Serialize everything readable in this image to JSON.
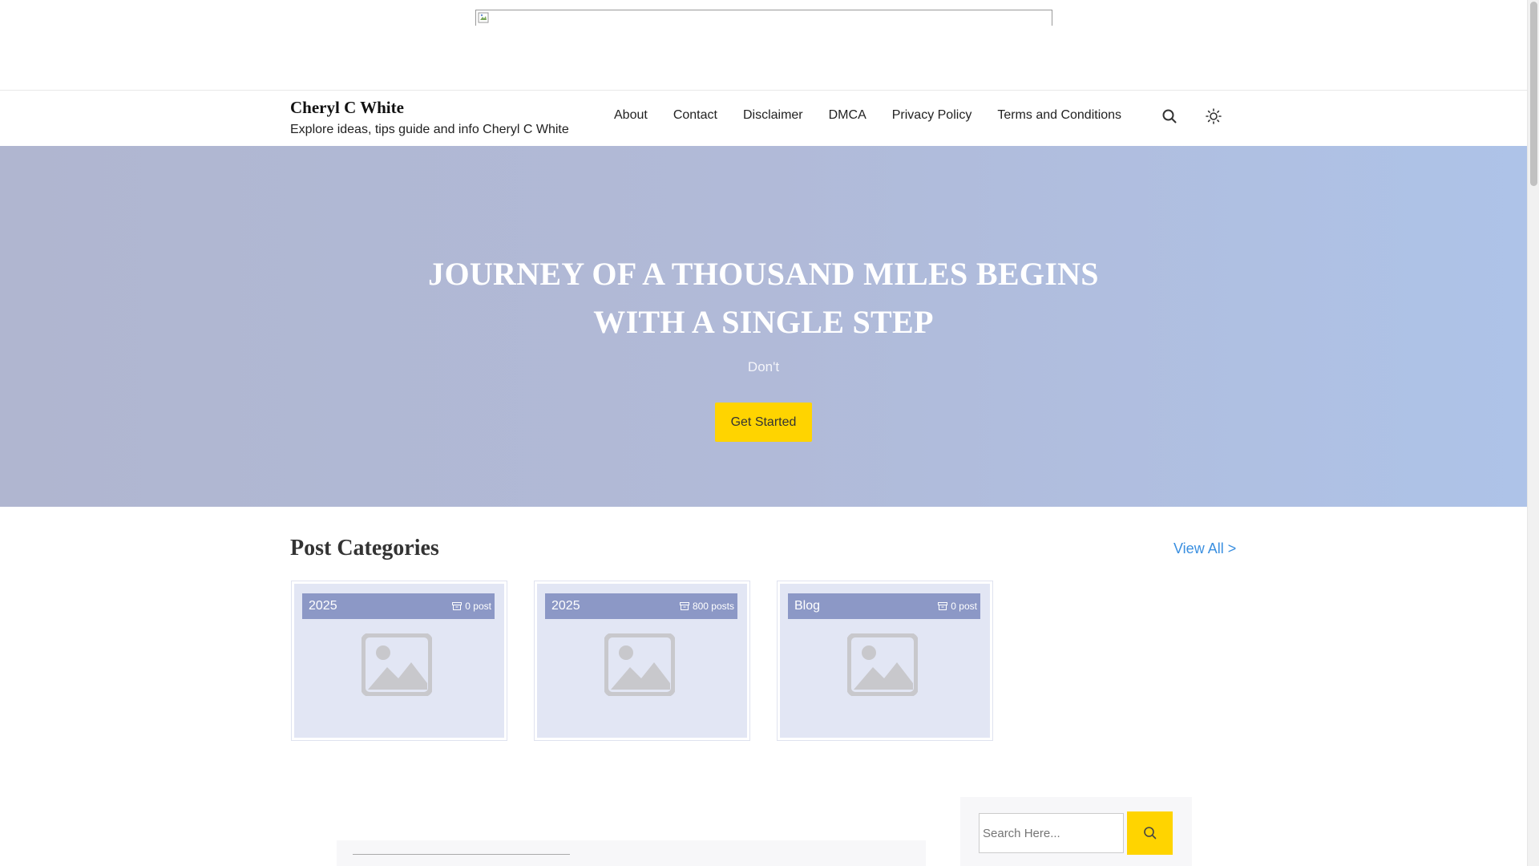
{
  "header": {
    "site_title": "Cheryl C White",
    "tagline": "Explore ideas, tips guide and info Cheryl C White",
    "nav": [
      "About",
      "Contact",
      "Disclaimer",
      "DMCA",
      "Privacy Policy",
      "Terms and Conditions"
    ],
    "icons": [
      "search-icon",
      "sun-icon"
    ]
  },
  "hero": {
    "title": "JOURNEY OF A THOUSAND MILES BEGINS WITH A SINGLE STEP",
    "subtitle": "Don't",
    "button_label": "Get Started"
  },
  "categories": {
    "heading": "Post Categories",
    "view_all": "View All >",
    "items": [
      {
        "name": "2025",
        "count": "0 post"
      },
      {
        "name": "2025",
        "count": "800 posts"
      },
      {
        "name": "Blog",
        "count": "0 post"
      }
    ]
  },
  "sidebar": {
    "search_placeholder": "Search Here..."
  },
  "colors": {
    "accent": "#ffd400",
    "link": "#3a8fe0",
    "category_bar": "#8c98c6"
  }
}
